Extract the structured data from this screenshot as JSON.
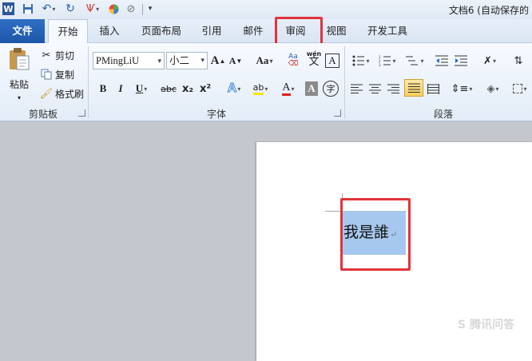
{
  "titlebar": {
    "title": "文档6 (自动保存的",
    "qat": {
      "app_icon_letter": "W",
      "save_icon": "save-icon",
      "undo_icon": "undo-icon",
      "redo_icon": "redo-icon",
      "format_painter_icon": "paint-icon",
      "color_icon": "color-wheel-icon",
      "eraser_icon": "eraser-icon",
      "customize_icon": "qat-dropdown-icon"
    }
  },
  "tabs": [
    {
      "label": "文件"
    },
    {
      "label": "开始"
    },
    {
      "label": "插入"
    },
    {
      "label": "页面布局"
    },
    {
      "label": "引用"
    },
    {
      "label": "邮件"
    },
    {
      "label": "审阅"
    },
    {
      "label": "视图"
    },
    {
      "label": "开发工具"
    }
  ],
  "active_tab": "开始",
  "highlighted_tab": "审阅",
  "colors": {
    "file_tab": "#1d56a8",
    "highlight": "#e0343a",
    "selection": "#a6c8ee",
    "workspace": "#c4c8ce"
  },
  "clipboard": {
    "group_label": "剪贴板",
    "paste_label": "粘贴",
    "cut_label": "剪切",
    "copy_label": "复制",
    "format_painter_label": "格式刷"
  },
  "font": {
    "group_label": "字体",
    "font_name": "PMingLiU",
    "font_size": "小二",
    "grow_glyph": "A",
    "shrink_glyph": "A",
    "change_case_glyph": "Aa",
    "phonetic_glyph": "wén",
    "phonetic_char": "文",
    "border_glyph": "A",
    "bold": "B",
    "italic": "I",
    "underline": "U",
    "strike": "abc",
    "subscript": "x₂",
    "superscript": "x²",
    "effects_glyph": "A",
    "highlight_glyph": "ab",
    "font_color_glyph": "A",
    "shading_glyph": "A",
    "enclose_glyph": "字"
  },
  "paragraph": {
    "group_label": "段落"
  },
  "document": {
    "selected_text": "我是誰",
    "paragraph_mark": "↵",
    "watermark": "S 腾讯问答"
  }
}
